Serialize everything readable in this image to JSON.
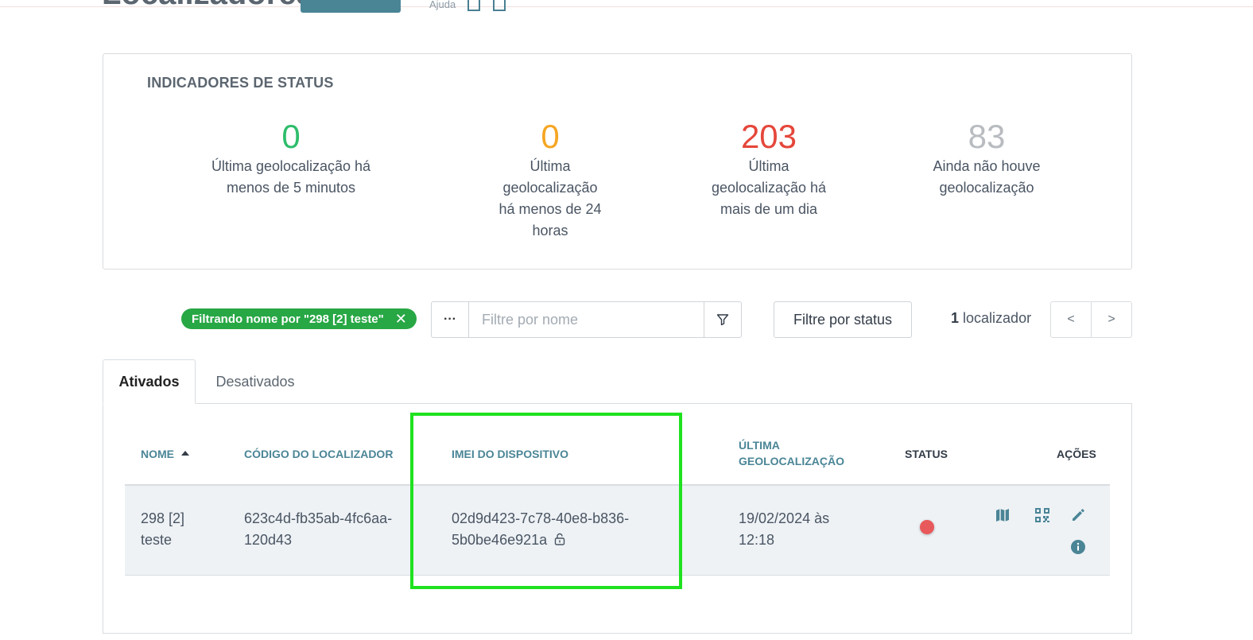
{
  "header": {
    "page_title": "Localizadores",
    "help_label": "Ajuda"
  },
  "status_card": {
    "heading": "INDICADORES DE STATUS",
    "indicators": [
      {
        "value": "0",
        "label": "Última geolocalização há menos de 5 minutos",
        "color": "#2ebd6b"
      },
      {
        "value": "0",
        "label": "Última geolocalização há menos de 24 horas",
        "color": "#f5a623"
      },
      {
        "value": "203",
        "label": "Última geolocalização há mais de um dia",
        "color": "#e5473b"
      },
      {
        "value": "83",
        "label": "Ainda não houve geolocalização",
        "color": "#b8bcc0"
      }
    ]
  },
  "filters": {
    "active_filter_chip": "Filtrando nome por \"298 [2] teste\"",
    "more_options_label": "···",
    "name_placeholder": "Filtre por nome",
    "status_filter_label": "Filtre por status",
    "count_value": "1",
    "count_label": "localizador",
    "prev_label": "<",
    "next_label": ">"
  },
  "tabs": [
    {
      "label": "Ativados",
      "active": true
    },
    {
      "label": "Desativados",
      "active": false
    }
  ],
  "table": {
    "headers": {
      "name": "NOME",
      "code": "CÓDIGO DO LOCALIZADOR",
      "imei": "IMEI DO DISPOSITIVO",
      "last_geo": "ÚLTIMA GEOLOCALIZAÇÃO",
      "status": "STATUS",
      "actions": "AÇÕES"
    },
    "rows": [
      {
        "name": "298 [2] teste",
        "code": "623c4d-fb35ab-4fc6aa-120d43",
        "imei": "02d9d423-7c78-40e8-b836-5b0be46e921a",
        "last_geo": "19/02/2024 às 12:18",
        "status_color": "#e8595b"
      }
    ]
  },
  "colors": {
    "accent": "#4a8596",
    "chip_green": "#28a745",
    "highlight": "#1fe21f"
  }
}
